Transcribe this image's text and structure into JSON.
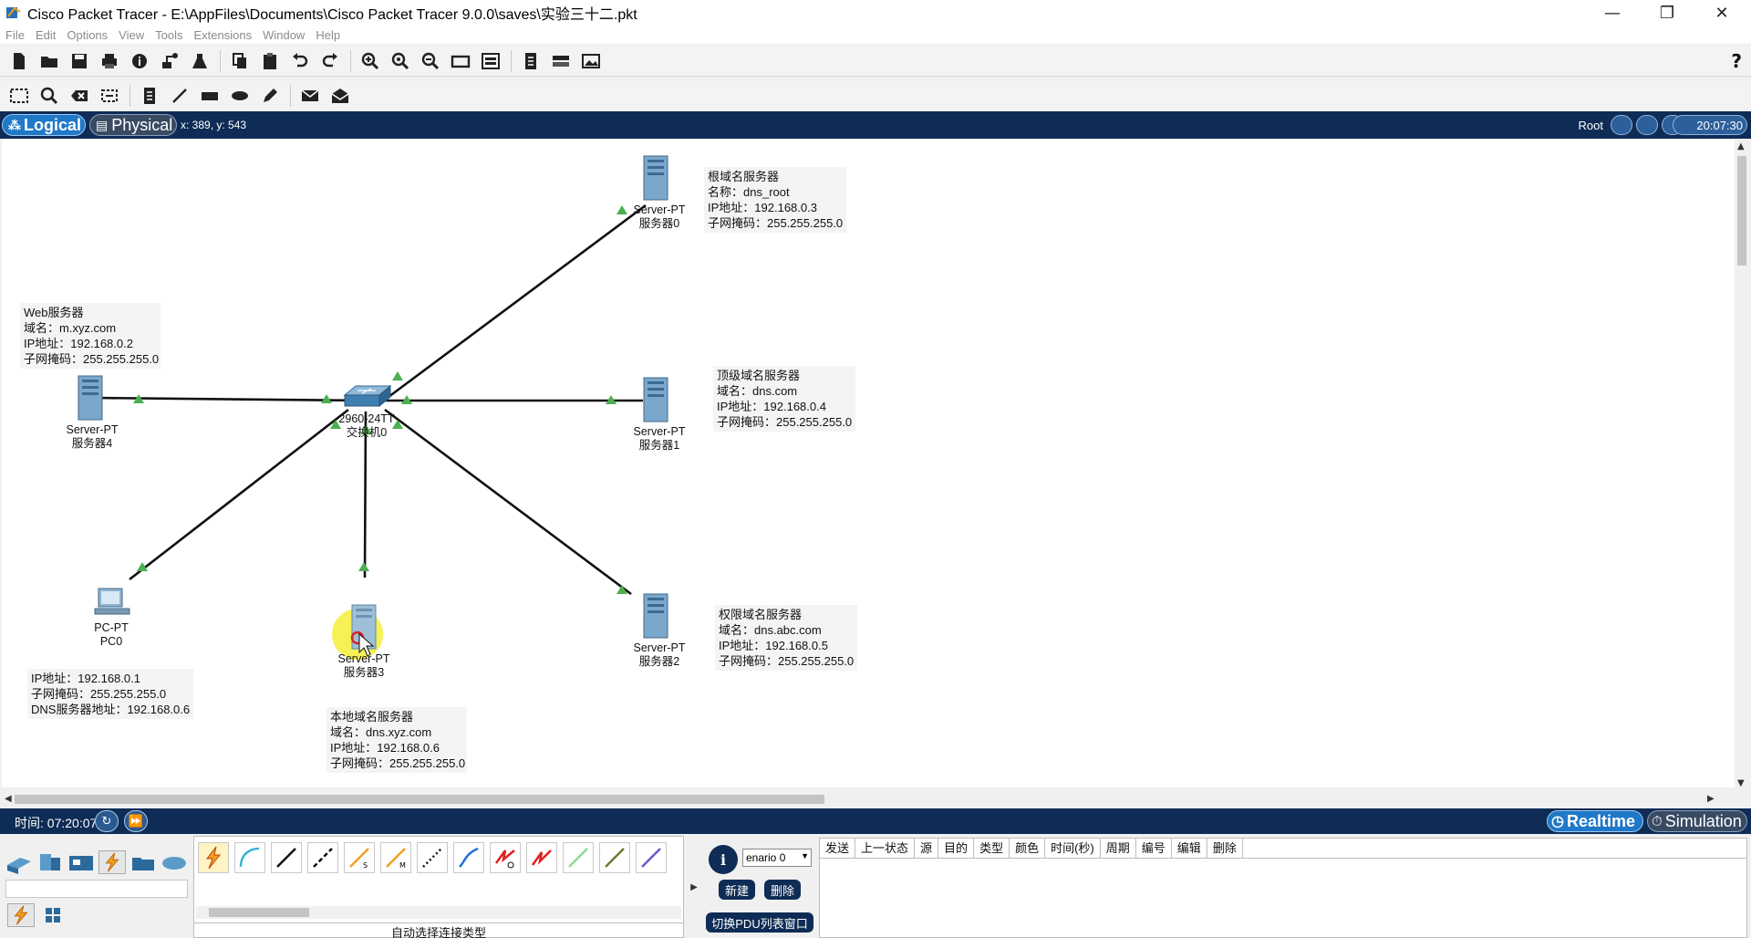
{
  "window": {
    "title": "Cisco Packet Tracer - E:\\AppFiles\\Documents\\Cisco Packet Tracer 9.0.0\\saves\\实验三十二.pkt",
    "controls": [
      "—",
      "❐",
      "✕"
    ]
  },
  "menu": [
    "File",
    "Edit",
    "Options",
    "View",
    "Tools",
    "Extensions",
    "Window",
    "Help"
  ],
  "toolbar": {
    "help": "?"
  },
  "modebar": {
    "logical": "Logical",
    "physical": "Physical",
    "coords": "x: 389, y: 543",
    "root": "Root",
    "clock": "20:07:30"
  },
  "devices": {
    "server0": {
      "model": "Server-PT",
      "name": "服务器0"
    },
    "server1": {
      "model": "Server-PT",
      "name": "服务器1"
    },
    "server2": {
      "model": "Server-PT",
      "name": "服务器2"
    },
    "server3": {
      "model": "Server-PT",
      "name": "服务器3"
    },
    "server4": {
      "model": "Server-PT",
      "name": "服务器4"
    },
    "pc0": {
      "model": "PC-PT",
      "name": "PC0"
    },
    "switch0": {
      "model": "2960-24TT",
      "name": "交换机0"
    }
  },
  "notes": {
    "root_dns": [
      "根域名服务器",
      "名称：dns_root",
      "IP地址：192.168.0.3",
      "子网掩码：255.255.255.0"
    ],
    "web": [
      "Web服务器",
      "域名：m.xyz.com",
      "IP地址：192.168.0.2",
      "子网掩码：255.255.255.0"
    ],
    "tld_dns": [
      "顶级域名服务器",
      "域名：dns.com",
      "IP地址：192.168.0.4",
      "子网掩码：255.255.255.0"
    ],
    "auth_dns": [
      "权限域名服务器",
      "域名：dns.abc.com",
      "IP地址：192.168.0.5",
      "子网掩码：255.255.255.0"
    ],
    "pc": [
      "IP地址：192.168.0.1",
      "子网掩码：255.255.255.0",
      "DNS服务器地址：192.168.0.6"
    ],
    "local_dns": [
      "本地域名服务器",
      "域名：dns.xyz.com",
      "IP地址：192.168.0.6",
      "子网掩码：255.255.255.0"
    ]
  },
  "status": {
    "time": "时间: 07:20:07",
    "realtime": "Realtime",
    "simulation": "Simulation"
  },
  "bottom": {
    "connection_caption": "自动选择连接类型",
    "scenario": "enario 0",
    "new_button": "新建",
    "delete_button": "删除",
    "toggle_pdu": "切换PDU列表窗口",
    "pdu_columns": [
      "发送",
      "上一状态",
      "源",
      "目的",
      "类型",
      "颜色",
      "时间(秒)",
      "周期",
      "编号",
      "编辑",
      "删除"
    ]
  }
}
